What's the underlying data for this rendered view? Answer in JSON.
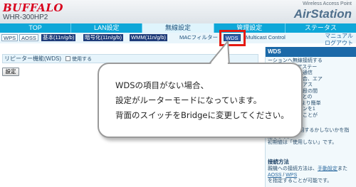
{
  "header": {
    "logo": "BUFFALO",
    "model": "WHR-300HP2",
    "brand_sub": "Wireless Access Point",
    "brand_main": "AirStation"
  },
  "main_nav": {
    "tabs": [
      {
        "label": "TOP",
        "active": false
      },
      {
        "label": "LAN設定",
        "active": false
      },
      {
        "label": "無線設定",
        "active": true
      },
      {
        "label": "管理設定",
        "active": false
      },
      {
        "label": "ステータス",
        "active": false
      }
    ]
  },
  "sub_nav": {
    "items": [
      {
        "label": "WPS"
      },
      {
        "label": "AOSS"
      },
      {
        "label": "基本(11n/g/b)"
      },
      {
        "label": "暗号化(11n/g/b)"
      },
      {
        "label": "WMM(11n/g/b)"
      },
      {
        "label": "MACフィルター"
      },
      {
        "label": "WDS",
        "current": true
      },
      {
        "label": "Multicast Control"
      }
    ],
    "manual_link": "マニュアル",
    "logout_link": "ログアウト"
  },
  "content": {
    "setting_label": "リピーター機能(WDS)",
    "checkbox_label": "使用する",
    "checkbox_checked": false,
    "submit_label": "設定"
  },
  "help": {
    "title": "WDS",
    "text1": "ーションへ無線接続する\nています。エアステー\n線の距離が遠く通信\nより不安定な場合、エア\n機を使用したエアス\n線接続と無線手段の間\nより、無線手段との\nます。AOSSにより簡単\nエアステーションを1\n間接続設定することが",
    "text2": "WDS機能を使用するかしないかを指\n定します。\n初期値は「使用しない」です。",
    "heading": "接続方法",
    "text3a": "親機への接続方法は、",
    "link_manual_setting": "手動設定",
    "text3b": "また",
    "link_aoss": "AOSS",
    "separator": " / ",
    "link_wps": "WPS",
    "text3c": "を指定することが可能です。"
  },
  "callout": {
    "line1": "WDSの項目がない場合、",
    "line2": "設定がルーターモードになっています。",
    "line3": "背面のスイッチをBridgeに変更してください。"
  }
}
